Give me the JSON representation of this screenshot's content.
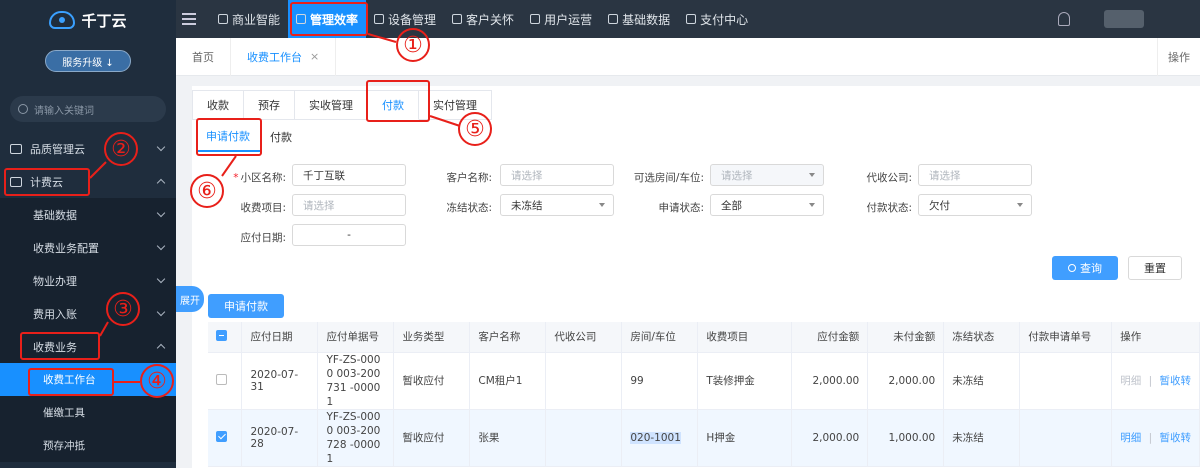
{
  "sidebar": {
    "logo": "千丁云",
    "upgrade_label": "服务升级 ↓",
    "search_placeholder": "请输入关键词",
    "items": [
      {
        "label": "品质管理云"
      },
      {
        "label": "计费云"
      },
      {
        "label": "基础数据"
      },
      {
        "label": "收费业务配置"
      },
      {
        "label": "物业办理"
      },
      {
        "label": "费用入账"
      },
      {
        "label": "收费业务"
      },
      {
        "label": "收费工作台"
      },
      {
        "label": "催缴工具"
      },
      {
        "label": "预存冲抵"
      }
    ]
  },
  "topnav": {
    "items": [
      {
        "label": "商业智能"
      },
      {
        "label": "管理效率"
      },
      {
        "label": "设备管理"
      },
      {
        "label": "客户关怀"
      },
      {
        "label": "用户运营"
      },
      {
        "label": "基础数据"
      },
      {
        "label": "支付中心"
      }
    ]
  },
  "tabstrip": {
    "home": "首页",
    "current": "收费工作台",
    "close": "×",
    "ops": "操作"
  },
  "tabs1": [
    "收款",
    "预存",
    "实收管理",
    "付款",
    "实付管理"
  ],
  "tabs2": [
    "申请付款",
    "付款"
  ],
  "filters": {
    "community_label": "小区名称:",
    "community_value": "千丁互联",
    "customer_label": "客户名称:",
    "customer_ph": "请选择",
    "room_label": "可选房间/车位:",
    "room_ph": "请选择",
    "agency_label": "代收公司:",
    "agency_ph": "请选择",
    "item_label": "收费项目:",
    "item_ph": "请选择",
    "freeze_label": "冻结状态:",
    "freeze_value": "未冻结",
    "apply_label": "申请状态:",
    "apply_value": "全部",
    "pay_label": "付款状态:",
    "pay_value": "欠付",
    "due_label": "应付日期:",
    "due_value": "-"
  },
  "buttons": {
    "query": "查询",
    "reset": "重置",
    "apply_pay": "申请付款",
    "expand": "展开"
  },
  "table": {
    "headers": [
      "应付日期",
      "应付单据号",
      "业务类型",
      "客户名称",
      "代收公司",
      "房间/车位",
      "收费项目",
      "应付金额",
      "未付金额",
      "冻结状态",
      "付款申请单号",
      "操作"
    ],
    "rows": [
      {
        "date": "2020-07-31",
        "doc": "YF-ZS-0000 003-200731 -00001",
        "type": "暂收应付",
        "customer": "CM租户1",
        "agency": "",
        "room": "99",
        "item": "T装修押金",
        "due": "2,000.00",
        "unpaid": "2,000.00",
        "freeze": "未冻结",
        "apply_no": "",
        "op1": "明细",
        "op2": "暂收转"
      },
      {
        "date": "2020-07-28",
        "doc": "YF-ZS-0000 003-200728 -00001",
        "type": "暂收应付",
        "customer": "张果",
        "agency": "",
        "room": "020-1001",
        "item": "H押金",
        "due": "2,000.00",
        "unpaid": "1,000.00",
        "freeze": "未冻结",
        "apply_no": "",
        "op1": "明细",
        "op2": "暂收转"
      }
    ]
  },
  "annotations": [
    "①",
    "②",
    "③",
    "④",
    "⑤",
    "⑥"
  ],
  "colors": {
    "accent": "#1890ff",
    "annotation": "#e8201a",
    "sidebar": "#1f2d3d"
  }
}
